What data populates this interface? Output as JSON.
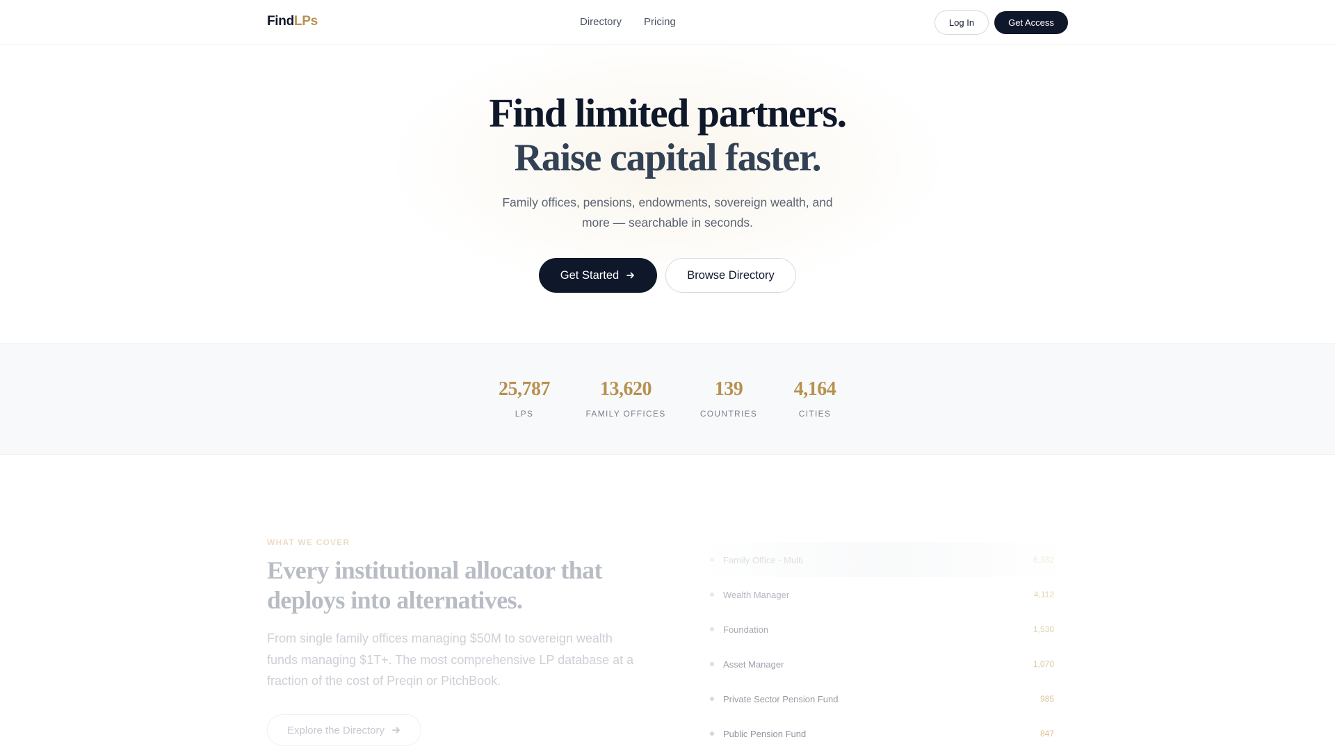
{
  "nav": {
    "brand_find": "Find",
    "brand_lps": "LPs",
    "links": [
      "Directory",
      "Pricing"
    ],
    "login_label": "Log In",
    "access_label": "Get Access"
  },
  "hero": {
    "title": "Find limited partners.",
    "subtitle": "Raise capital faster.",
    "description": "Family offices, pensions, endowments, sovereign wealth, and more — searchable in seconds.",
    "cta_primary": "Get Started",
    "cta_primary_icon": "arrow-right-icon",
    "cta_secondary": "Browse Directory"
  },
  "stats": [
    {
      "value": "25,787",
      "label": "LPS"
    },
    {
      "value": "13,620",
      "label": "FAMILY OFFICES"
    },
    {
      "value": "139",
      "label": "COUNTRIES"
    },
    {
      "value": "4,164",
      "label": "CITIES"
    }
  ],
  "coverage": {
    "eyebrow": "WHAT WE COVER",
    "title": "Every institutional allocator that deploys into alternatives.",
    "description": "From single family offices managing $50M to sovereign wealth funds managing $1T+. The most comprehensive LP database at a fraction of the cost of Preqin or PitchBook.",
    "cta": "Explore the Directory",
    "cta_icon": "arrow-right-icon",
    "types": [
      {
        "name": "Family Office - Multi",
        "count": "6,332"
      },
      {
        "name": "Wealth Manager",
        "count": "4,112"
      },
      {
        "name": "Foundation",
        "count": "1,530"
      },
      {
        "name": "Asset Manager",
        "count": "1,070"
      },
      {
        "name": "Private Sector Pension Fund",
        "count": "985"
      },
      {
        "name": "Public Pension Fund",
        "count": "847"
      }
    ]
  },
  "colors": {
    "brand_gold": "#b7914f",
    "navy": "#0f172a",
    "stats_bg": "#f8f9fb"
  }
}
